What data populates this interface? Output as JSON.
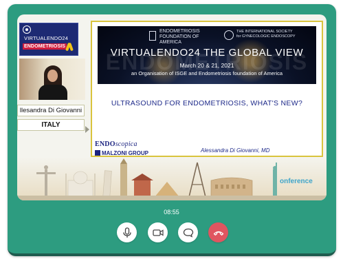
{
  "event": {
    "logo_title": "VIRTUALENDO24",
    "logo_subtitle": "ENDOMETRIOSIS"
  },
  "speaker": {
    "name": "llesandra Di Giovanni",
    "country": "ITALY"
  },
  "slide": {
    "watermark": "ENDOMETRIOSIS",
    "org1": [
      "ENDOMETRIOSIS",
      "FOUNDATION OF",
      "AMERICA"
    ],
    "org2": [
      "THE INTERNATIONAL SOCIETY",
      "for GYNECOLOGIC ENDOSCOPY"
    ],
    "title": "VIRTUALENDO24 THE GLOBAL VIEW",
    "dates": "March 20 & 21, 2021",
    "org_line": "an Organisation of ISGE and Endometriosis foundation of America",
    "heading": "ULTRASOUND FOR ENDOMETRIOSIS, WHAT'S NEW?",
    "sponsor1_bold": "ENDO",
    "sponsor1_italic": "scopica",
    "sponsor2": "MALZONI GROUP",
    "author": "Alessandra Di Giovanni, MD"
  },
  "background": {
    "conference_text": "onference"
  },
  "call": {
    "elapsed": "08:55"
  },
  "controls": {
    "mic_icon": "microphone-icon",
    "camera_icon": "video-camera-icon",
    "chat_icon": "chat-bubble-icon",
    "hangup_icon": "hang-up-phone-icon"
  },
  "colors": {
    "frame": "#2d9c80",
    "hangup": "#e05560",
    "slide_text": "#1e2a8a"
  }
}
